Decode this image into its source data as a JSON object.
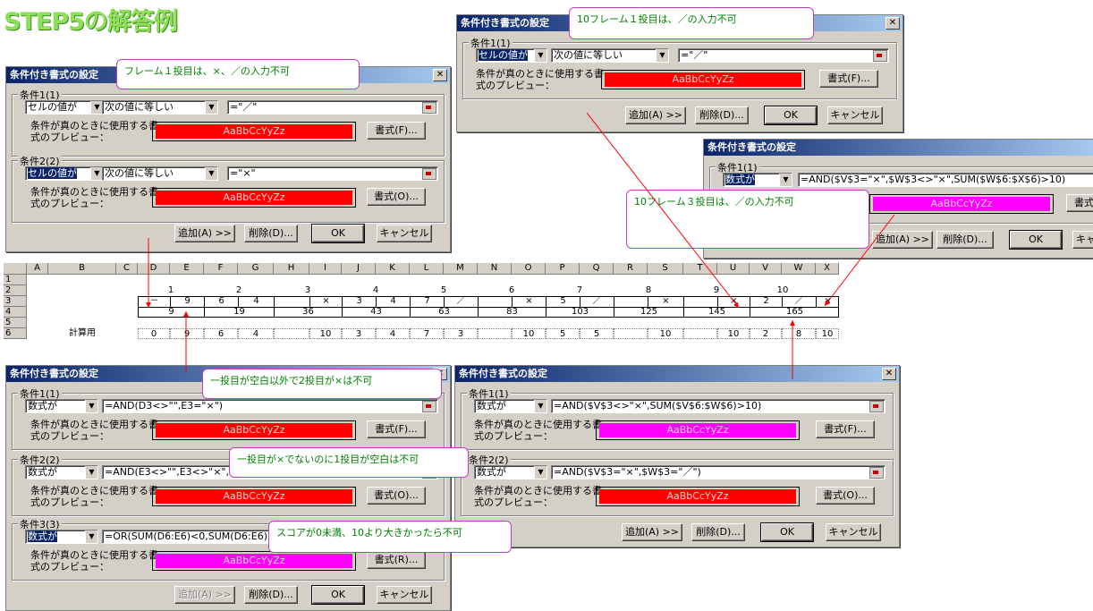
{
  "page_title": "STEP5の解答例",
  "colors": {
    "title": "#8ee05a",
    "preview_red": "#ff0000",
    "preview_magenta": "#ff00ff",
    "note_text": "#008000",
    "arrow": "#ff0000"
  },
  "dialog_title": "条件付き書式の設定",
  "preview_label_1": "条件が真のときに使用する書",
  "preview_label_2": "式のプレビュー：",
  "preview_sample": "AaBbCcYyZz",
  "buttons": {
    "add": "追加(A) >>",
    "delete": "削除(D)...",
    "ok": "OK",
    "cancel": "キャンセル",
    "format_f": "書式(F)...",
    "format_o": "書式(O)...",
    "format_r": "書式(R)..."
  },
  "conditions": {
    "c1": "条件1(1)",
    "c2": "条件2(2)",
    "c3": "条件3(3)"
  },
  "ops": {
    "cell_value": "セルの値が",
    "formula": "数式が",
    "equal": "次の値に等しい"
  },
  "dlg_a": {
    "c1_formula": "=\"／\"",
    "c2_formula": "=\"×\""
  },
  "dlg_b": {
    "c1_formula": "=\"／\""
  },
  "dlg_c": {
    "c1_formula": "=AND($V$3=\"×\",$W$3<>\"×\",SUM($W$6:$X$6)>10)"
  },
  "dlg_d": {
    "c1_formula": "=AND(D3<>\"\",E3=\"×\")",
    "c2_formula": "=AND(E3<>\"\",E3<>\"×\",D3=\"\")",
    "c3_formula": "=OR(SUM(D6:E6)<0,SUM(D6:E6)>10)"
  },
  "dlg_e": {
    "c1_formula": "=AND($V$3<>\"×\",SUM($V$6:$W$6)>10)",
    "c2_formula": "=AND($V$3=\"×\",$W$3=\"／\")"
  },
  "notes": {
    "n1": "フレーム１投目は、×、／の入力不可",
    "n2": "10フレーム１投目は、／の入力不可",
    "n3": "10フレーム３投目は、／の入力不可",
    "n4": "一投目が空白以外で2投目が×は不可",
    "n5": "一投目が×でないのに1投目が空白は不可",
    "n6": "スコアが0未満、10より大きかったら不可"
  },
  "sheet": {
    "columns": [
      "A",
      "B",
      "C",
      "D",
      "E",
      "F",
      "G",
      "H",
      "I",
      "J",
      "K",
      "L",
      "M",
      "N",
      "O",
      "P",
      "Q",
      "R",
      "S",
      "T",
      "U",
      "V",
      "W",
      "X"
    ],
    "rows": [
      "1",
      "2",
      "3",
      "4",
      "5",
      "6"
    ],
    "frames": [
      "1",
      "2",
      "3",
      "4",
      "5",
      "6",
      "7",
      "8",
      "9",
      "10"
    ],
    "throws": [
      "－",
      "9",
      "6",
      "4",
      "",
      "×",
      "3",
      "4",
      "7",
      "／",
      "",
      "×",
      "5",
      "／",
      "",
      "×",
      "",
      "×",
      "2",
      "／",
      "×"
    ],
    "scores": [
      "9",
      "19",
      "36",
      "43",
      "63",
      "83",
      "103",
      "125",
      "145",
      "165"
    ],
    "calc_label": "計算用",
    "calc": [
      "0",
      "9",
      "6",
      "4",
      "",
      "10",
      "3",
      "4",
      "7",
      "3",
      "",
      "10",
      "5",
      "5",
      "",
      "10",
      "",
      "10",
      "2",
      "8",
      "10"
    ]
  }
}
